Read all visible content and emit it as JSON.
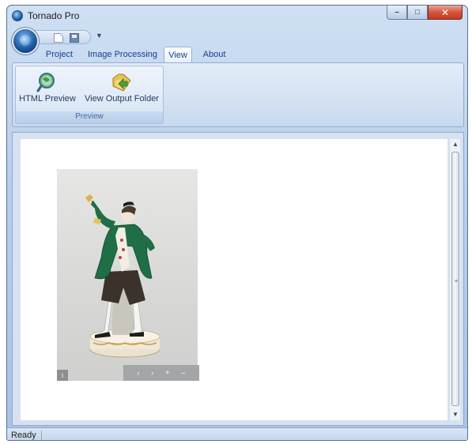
{
  "window": {
    "title": "Tornado Pro",
    "minimize_glyph": "–",
    "restore_glyph": "□",
    "close_glyph": "✕"
  },
  "quick_access": {
    "items": [
      "new-document-icon",
      "save-icon"
    ],
    "dropdown_glyph": "▼"
  },
  "tabs": [
    {
      "label": "Project"
    },
    {
      "label": "Image Processing"
    },
    {
      "label": "View",
      "active": true
    },
    {
      "label": "About"
    }
  ],
  "ribbon": {
    "group": {
      "label": "Preview",
      "buttons": [
        {
          "label": "HTML Preview",
          "icon": "magnifier-globe-icon"
        },
        {
          "label": "View Output Folder",
          "icon": "folder-arrow-icon"
        }
      ]
    }
  },
  "preview": {
    "image_subject": "porcelain figurine of a gentleman",
    "info_label": "i",
    "controls": {
      "prev": "‹",
      "next": "›",
      "zoom_in": "+",
      "zoom_out": "–"
    }
  },
  "scrollbar": {
    "up": "▲",
    "down": "▼",
    "grip": "≡"
  },
  "status": {
    "text": "Ready"
  }
}
